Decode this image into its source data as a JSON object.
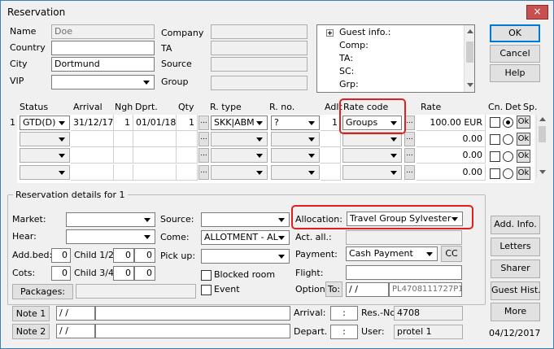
{
  "window": {
    "title": "Reservation",
    "close_label": "×"
  },
  "guest": {
    "name_label": "Name",
    "name_value": "Doe",
    "country_label": "Country",
    "country_value": "",
    "city_label": "City",
    "city_value": "Dortmund",
    "vip_label": "VIP",
    "vip_value": "",
    "company_label": "Company",
    "company_value": "",
    "ta_label": "TA",
    "ta_value": "",
    "source_label": "Source",
    "source_value": "",
    "group_label": "Group",
    "group_value": ""
  },
  "tree": {
    "items": [
      "Guest info.:",
      "Comp:",
      "TA:",
      "SC:",
      "Grp:"
    ]
  },
  "buttons": {
    "ok": "OK",
    "cancel": "Cancel",
    "help": "Help",
    "add_info": "Add. Info.",
    "letters": "Letters",
    "sharer": "Sharer",
    "guest_hist": "Guest Hist.",
    "more": "More",
    "packages": "Packages:",
    "cc": "CC",
    "to": "To:",
    "note1": "Note 1",
    "note2": "Note 2",
    "dots": "..."
  },
  "grid": {
    "headers": {
      "status": "Status",
      "arrival": "Arrival",
      "ngh": "Ngh",
      "dprt": "Dprt.",
      "qty": "Qty",
      "rtype": "R. type",
      "rno": "R. no.",
      "adlt": "Adlt",
      "ratecode": "Rate code",
      "rate": "Rate",
      "cn": "Cn.",
      "det": "Det",
      "sp": "Sp."
    },
    "row1": {
      "index": "1",
      "status": "GTD(D)",
      "arrival": "31/12/17",
      "ngh": "1",
      "dprt": "01/01/18",
      "qty": "1",
      "rtype": "SKK|ABM",
      "rno": "?",
      "adlt": "1",
      "ratecode": "Groups",
      "rate": "100.00 EUR",
      "ok": "Ok"
    },
    "row2": {
      "rate": "0.00",
      "ok": "Ok"
    },
    "row3": {
      "rate": "0.00",
      "ok": "Ok"
    },
    "row4": {
      "rate": "0.00",
      "ok": "Ok"
    }
  },
  "details": {
    "group_title": "Reservation details for 1",
    "market_label": "Market:",
    "market_value": "",
    "hear_label": "Hear:",
    "hear_value": "",
    "addbed_label": "Add.bed:",
    "addbed_value": "0",
    "child12_label": "Child 1/2",
    "child12_a": "0",
    "child12_b": "0",
    "cots_label": "Cots:",
    "cots_value": "0",
    "child34_label": "Child 3/4",
    "child34_a": "0",
    "child34_b": "0",
    "source_label": "Source:",
    "source_value": "",
    "come_label": "Come:",
    "come_value": "ALLOTMENT - AL",
    "pickup_label": "Pick up:",
    "pickup_value": "",
    "blocked_label": "Blocked room",
    "event_label": "Event",
    "allocation_label": "Allocation:",
    "allocation_value": "Travel Group Sylvester",
    "actall_label": "Act. all.:",
    "actall_value": "",
    "payment_label": "Payment:",
    "payment_value": "Cash Payment",
    "flight_label": "Flight:",
    "flight_value": "",
    "option_label": "Option",
    "option_date": "/  /",
    "option_code": "PL4708111727P1"
  },
  "notes": {
    "note1_date": "/  /",
    "note1_text": "",
    "note2_date": "/  /",
    "note2_text": "",
    "arrival_label": "Arrival:",
    "arrival_value": ":",
    "depart_label": "Depart.",
    "depart_value": ":",
    "resno_label": "Res.-No",
    "resno_value": "4708",
    "user_label": "User:",
    "user_value": "protel 1",
    "date": "04/12/2017"
  },
  "colors": {
    "highlight": "#e02020",
    "accent": "#0078d7"
  }
}
